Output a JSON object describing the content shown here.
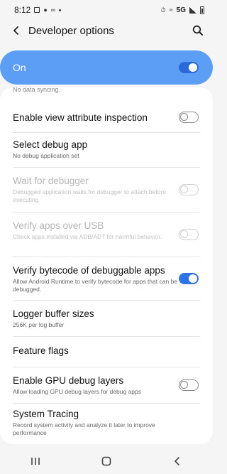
{
  "status_bar": {
    "time": "8:12",
    "network": "5G"
  },
  "header": {
    "title": "Developer options"
  },
  "master": {
    "label": "On",
    "state": "on"
  },
  "partial_text": "No data syncing.",
  "settings": [
    {
      "label": "Enable view attribute inspection",
      "desc": "",
      "toggle": "off",
      "disabled": false
    },
    {
      "label": "Select debug app",
      "desc": "No debug application set",
      "toggle": "none",
      "disabled": false
    },
    {
      "label": "Wait for debugger",
      "desc": "Debugged application waits for debugger to attach before executing",
      "toggle": "off",
      "disabled": true
    },
    {
      "label": "Verify apps over USB",
      "desc": "Check apps installed via ADB/ADT for harmful behavior.",
      "toggle": "off",
      "disabled": true
    },
    {
      "label": "Verify bytecode of debuggable apps",
      "desc": "Allow Android Runtime to verify bytecode for apps that can be debugged.",
      "toggle": "on",
      "disabled": false
    },
    {
      "label": "Logger buffer sizes",
      "desc": "256K per log buffer",
      "toggle": "none",
      "disabled": false
    },
    {
      "label": "Feature flags",
      "desc": "",
      "toggle": "none",
      "disabled": false
    },
    {
      "label": "Enable GPU debug layers",
      "desc": "Allow loading GPU debug layers for debug apps",
      "toggle": "off",
      "disabled": false
    },
    {
      "label": "System Tracing",
      "desc": "Record system activity and analyze it later to improve performance",
      "toggle": "none",
      "disabled": false
    }
  ],
  "colors": {
    "accent": "#2d74e6",
    "master_bg": "#5c9ef6",
    "background": "#f5f5f5"
  },
  "icons": {
    "back": "arrow-left-icon",
    "search": "search-icon",
    "nav_recents": "recents-icon",
    "nav_home": "home-icon",
    "nav_back": "back-icon"
  }
}
